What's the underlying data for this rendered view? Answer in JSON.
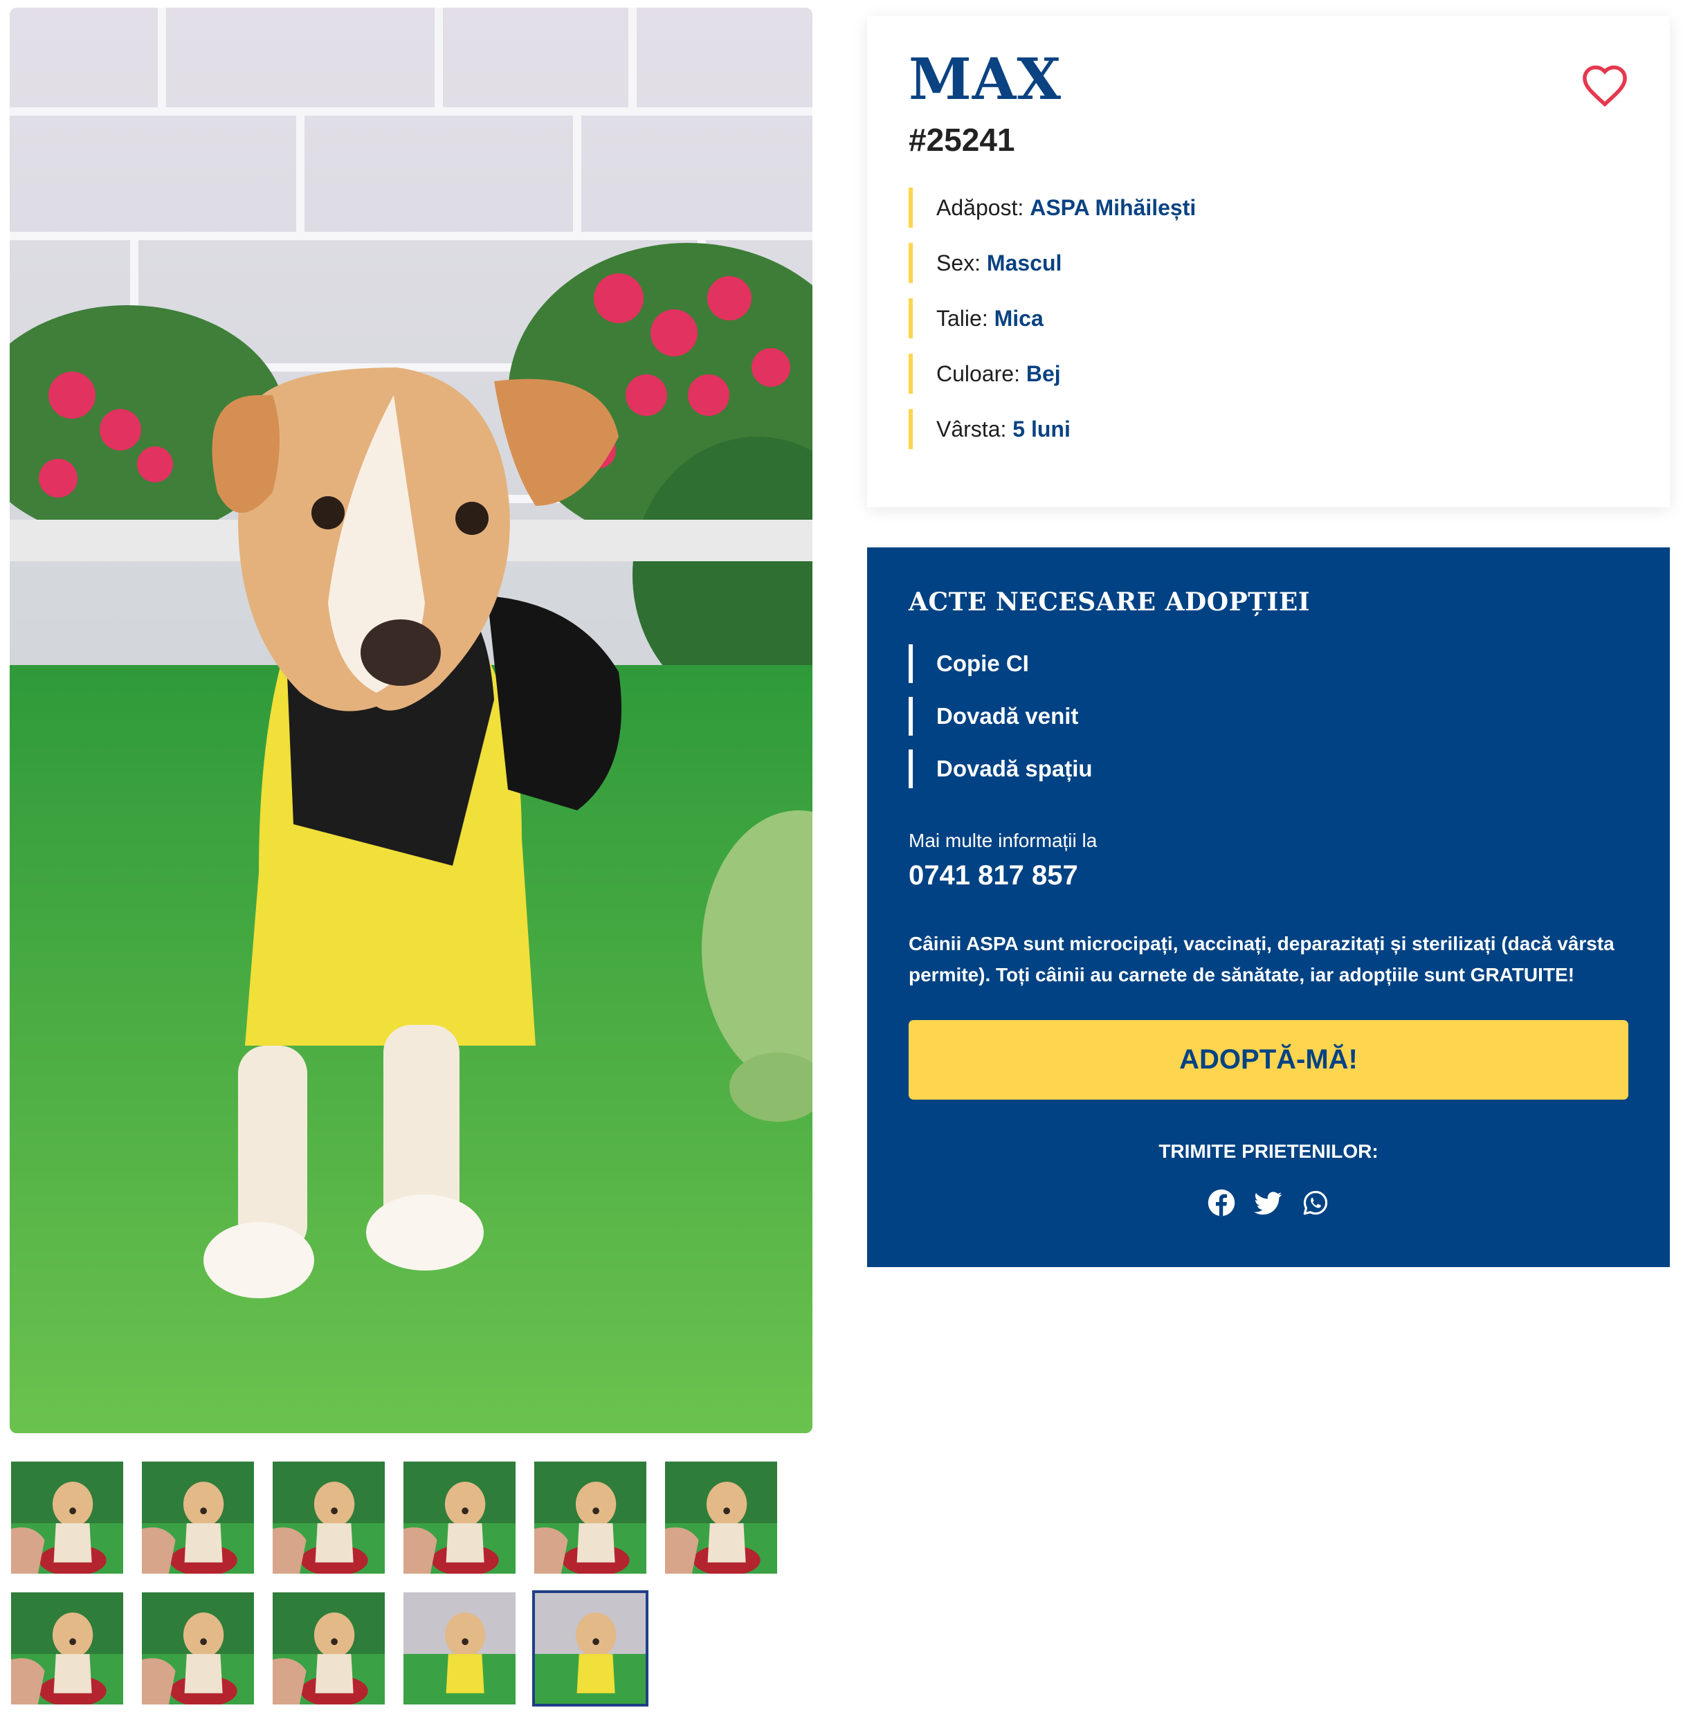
{
  "dog": {
    "name": "MAX",
    "id": "#25241",
    "attributes": [
      {
        "label": "Adăpost:",
        "value": "ASPA Mihăilești"
      },
      {
        "label": "Sex:",
        "value": "Mascul"
      },
      {
        "label": "Talie:",
        "value": "Mica"
      },
      {
        "label": "Culoare:",
        "value": "Bej"
      },
      {
        "label": "Vârsta:",
        "value": "5 luni"
      }
    ]
  },
  "adoption": {
    "title": "ACTE NECESARE ADOPȚIEI",
    "documents": [
      "Copie CI",
      "Dovadă venit",
      "Dovadă spațiu"
    ],
    "more_info_label": "Mai multe informații la",
    "phone": "0741 817 857",
    "note": "Câinii ASPA sunt microcipați, vaccinați, deparazitați și sterilizați (dacă vârsta permite). Toți câinii au carnete de sănătate, iar adopțiile sunt GRATUITE!",
    "button_label": "ADOPTĂ-MĂ!",
    "share_label": "TRIMITE PRIETENILOR:",
    "share_icons": [
      "facebook-icon",
      "twitter-icon",
      "whatsapp-icon"
    ]
  },
  "gallery": {
    "thumbnail_count": 11,
    "active_thumbnail": 10
  },
  "colors": {
    "brand_blue": "#004283",
    "accent_yellow": "#fdd54f",
    "heart_red": "#e53950"
  }
}
